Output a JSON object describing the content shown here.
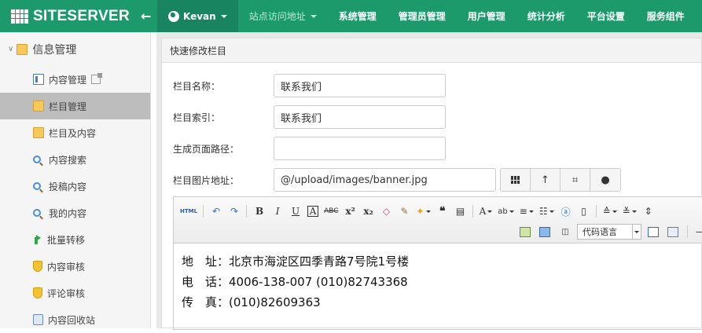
{
  "header": {
    "logo_text": "SITESERVER",
    "site_name": "Kevan",
    "nav": [
      "站点访问地址",
      "系统管理",
      "管理员管理",
      "用户管理",
      "统计分析",
      "平台设置",
      "服务组件"
    ]
  },
  "sidebar": {
    "root_label": "信息管理",
    "items": [
      {
        "label": "内容管理",
        "icon": "list-icon"
      },
      {
        "label": "栏目管理",
        "icon": "folder-icon",
        "active": true
      },
      {
        "label": "栏目及内容",
        "icon": "folder-icon"
      },
      {
        "label": "内容搜索",
        "icon": "search-icon"
      },
      {
        "label": "投稿内容",
        "icon": "search-icon"
      },
      {
        "label": "我的内容",
        "icon": "search-icon"
      },
      {
        "label": "批量转移",
        "icon": "arrow-icon"
      },
      {
        "label": "内容审核",
        "icon": "shield-icon"
      },
      {
        "label": "评论审核",
        "icon": "shield-icon"
      },
      {
        "label": "内容回收站",
        "icon": "recycle-icon"
      }
    ]
  },
  "panel": {
    "title": "快速修改栏目",
    "fields": {
      "name": {
        "label": "栏目名称：",
        "value": "联系我们"
      },
      "index": {
        "label": "栏目索引：",
        "value": "联系我们"
      },
      "path": {
        "label": "生成页面路径：",
        "value": ""
      },
      "image": {
        "label": "栏目图片地址：",
        "value": "@/upload/images/banner.jpg"
      }
    }
  },
  "editor": {
    "code_language_label": "代码语言",
    "html_label": "HTML",
    "lines": [
      "地　址：北京市海淀区四季青路7号院1号楼",
      "电　话：4006-138-007 (010)82743368",
      "传　真：(010)82609363"
    ]
  },
  "colors": {
    "topbar": "#1d9a6c",
    "site_dropdown": "#188460",
    "active_sidebar": "#bdbdbd"
  }
}
